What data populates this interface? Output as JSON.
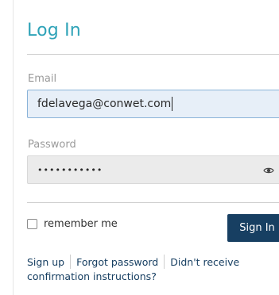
{
  "form": {
    "title": "Log In",
    "email_label": "Email",
    "email_value": "fdelavega@conwet.com",
    "password_label": "Password",
    "password_value": "•••••••••••",
    "remember_label": "remember me",
    "remember_checked": false,
    "signin_label": "Sign In"
  },
  "links": {
    "signup": "Sign up",
    "forgot": "Forgot password",
    "confirm": "Didn't receive confirmation instructions?"
  },
  "colors": {
    "title": "#2fa3b8",
    "button_bg": "#173f62",
    "link": "#173f62",
    "email_bg": "#e7eff8",
    "email_border": "#8ab3d9"
  },
  "icons": {
    "password_toggle": "eye-icon"
  }
}
